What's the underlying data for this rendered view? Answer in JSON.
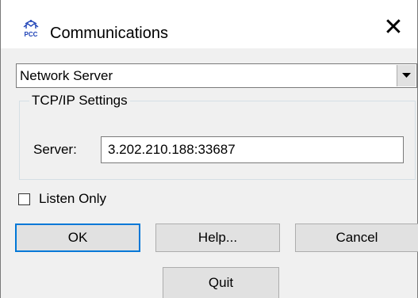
{
  "window": {
    "title": "Communications",
    "icon": "pcc-app-icon",
    "icon_label": "PCC",
    "close_glyph": "✕"
  },
  "connection_type": {
    "selected": "Network Server"
  },
  "tcpip_group": {
    "legend": "TCP/IP Settings",
    "server_label": "Server:",
    "server_value": "3.202.210.188:33687"
  },
  "listen_only": {
    "label": "Listen Only",
    "checked": false
  },
  "buttons": {
    "ok": "OK",
    "help": "Help...",
    "cancel": "Cancel",
    "quit": "Quit"
  },
  "colors": {
    "dialog_bg": "#f0f0f0",
    "focus_border": "#0078d7",
    "button_face": "#e1e1e1",
    "icon_blue": "#1a3fb5"
  }
}
